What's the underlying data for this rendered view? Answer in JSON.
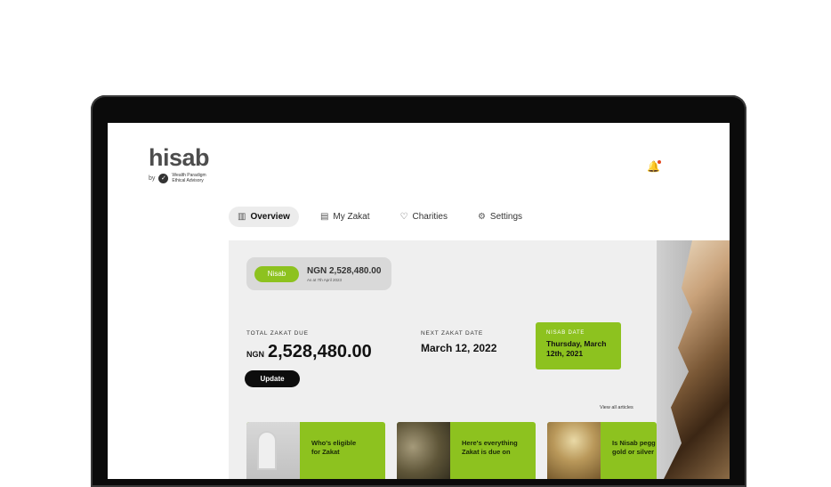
{
  "brand": {
    "name": "hisab",
    "by": "by",
    "partner": "Wealth Paradigm Ethical Advisory"
  },
  "tabs": [
    {
      "label": "Overview",
      "icon": "chart-icon",
      "active": true
    },
    {
      "label": "My Zakat",
      "icon": "wallet-icon",
      "active": false
    },
    {
      "label": "Charities",
      "icon": "heart-icon",
      "active": false
    },
    {
      "label": "Settings",
      "icon": "gear-icon",
      "active": false
    }
  ],
  "nisab": {
    "button": "Nisab",
    "amount": "NGN 2,528,480.00",
    "as_at": "As at 7th April 2023"
  },
  "total_zakat": {
    "label": "TOTAL ZAKAT DUE",
    "currency": "NGN",
    "amount": "2,528,480.00",
    "update_label": "Update"
  },
  "next_zakat": {
    "label": "NEXT ZAKAT DATE",
    "date": "March 12, 2022"
  },
  "nisab_date": {
    "label": "NISAB DATE",
    "date_line1": "Thursday, March",
    "date_line2": "12th, 2021"
  },
  "articles": {
    "view_all": "View all articles",
    "items": [
      {
        "title_l1": "Who's eligible",
        "title_l2": "for Zakat"
      },
      {
        "title_l1": "Here's everything",
        "title_l2": "Zakat is due on"
      },
      {
        "title_l1": "Is Nisab pegg",
        "title_l2": "gold or silver"
      }
    ]
  },
  "colors": {
    "accent": "#8dc21f",
    "dark": "#0d0d0d",
    "panel": "#efefef"
  }
}
